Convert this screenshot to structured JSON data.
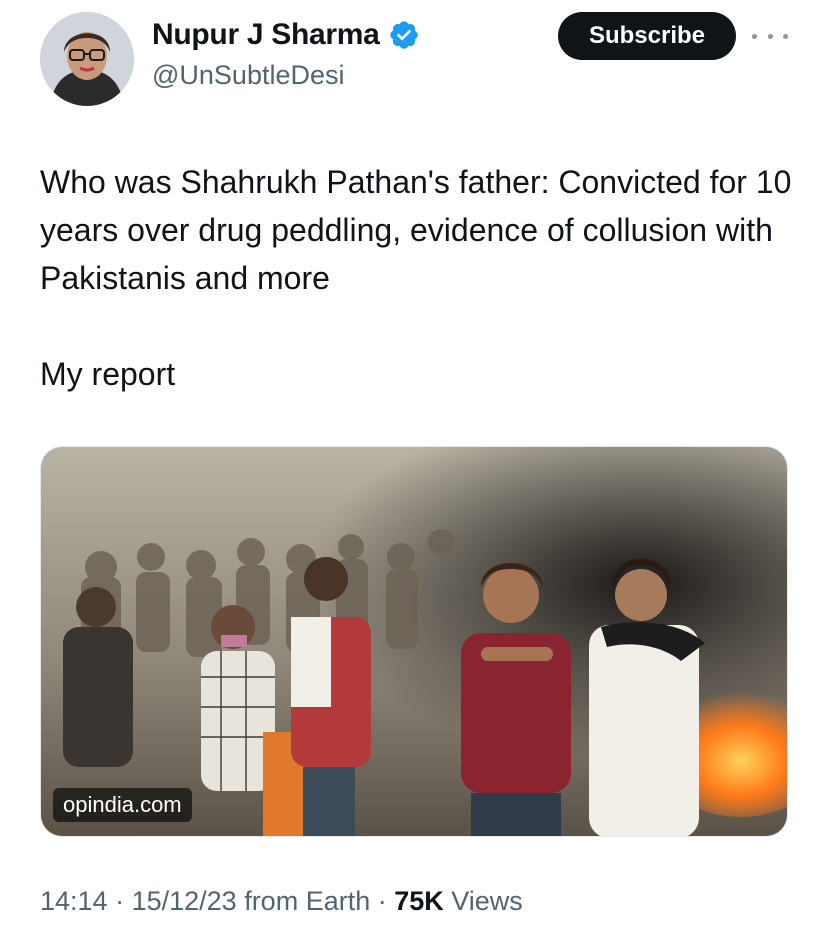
{
  "author": {
    "name": "Nupur J Sharma",
    "handle": "@UnSubtleDesi",
    "verified": true,
    "verified_color": "#1d9bf0"
  },
  "actions": {
    "subscribe_label": "Subscribe",
    "more_icon": "more-horizontal-icon"
  },
  "tweet": {
    "text": "Who was Shahrukh Pathan's father: Convicted for 10 years over drug peddling, evidence of collusion with Pakistanis and more",
    "text2": "My report"
  },
  "card": {
    "domain": "opindia.com"
  },
  "meta": {
    "time": "14:14",
    "sep1": " · ",
    "date": "15/12/23",
    "source": " from Earth",
    "sep2": " · ",
    "views_count": "75K",
    "views_label": " Views"
  },
  "colors": {
    "text": "#0f1419",
    "secondary": "#536471",
    "button_bg": "#0f1419"
  }
}
